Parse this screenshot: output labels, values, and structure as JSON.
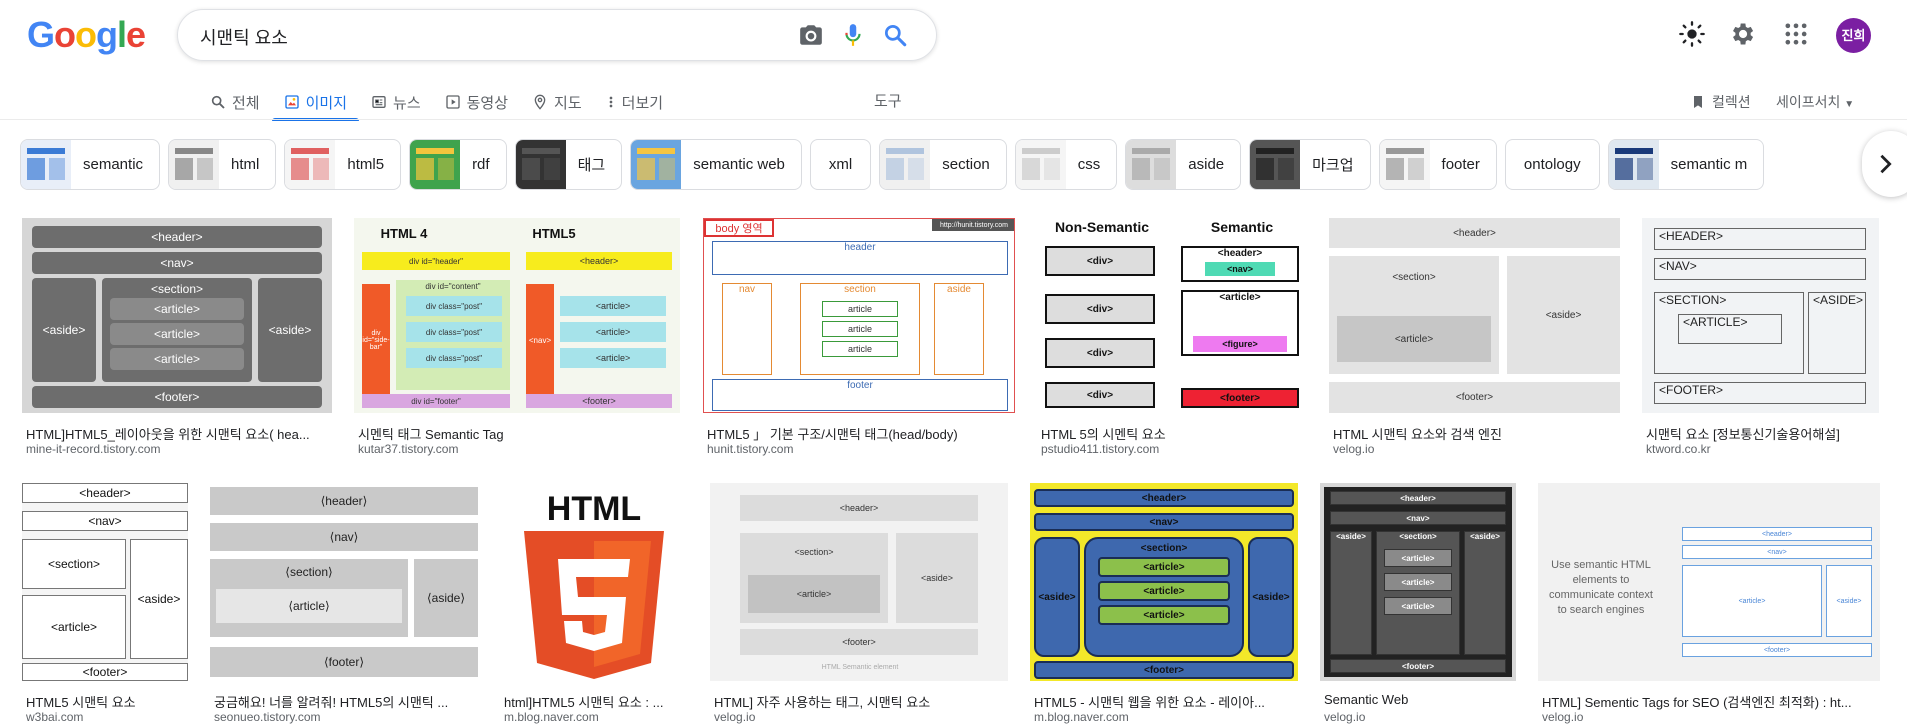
{
  "logo": "Google",
  "search": {
    "query": "시맨틱 요소"
  },
  "header": {
    "avatar_label": "진희"
  },
  "tabs": [
    {
      "label": "전체",
      "icon": "search-icon",
      "active": false
    },
    {
      "label": "이미지",
      "icon": "image-icon",
      "active": true
    },
    {
      "label": "뉴스",
      "icon": "news-icon",
      "active": false
    },
    {
      "label": "동영상",
      "icon": "video-icon",
      "active": false
    },
    {
      "label": "지도",
      "icon": "map-pin-icon",
      "active": false
    },
    {
      "label": "더보기",
      "icon": "more-vert-icon",
      "active": false
    }
  ],
  "tools_label": "도구",
  "collections_label": "컬렉션",
  "safesearch_label": "세이프서치",
  "chips": [
    {
      "label": "semantic",
      "thumb": true
    },
    {
      "label": "html",
      "thumb": true
    },
    {
      "label": "html5",
      "thumb": true
    },
    {
      "label": "rdf",
      "thumb": true
    },
    {
      "label": "태그",
      "thumb": true
    },
    {
      "label": "semantic web",
      "thumb": true
    },
    {
      "label": "xml",
      "thumb": false
    },
    {
      "label": "section",
      "thumb": true
    },
    {
      "label": "css",
      "thumb": true
    },
    {
      "label": "aside",
      "thumb": true
    },
    {
      "label": "마크업",
      "thumb": true
    },
    {
      "label": "footer",
      "thumb": true
    },
    {
      "label": "ontology",
      "thumb": false
    },
    {
      "label": "semantic m",
      "thumb": true
    }
  ],
  "results": [
    {
      "title": "HTML]HTML5_레이아웃을 위한 시맨틱 요소( hea...",
      "domain": "mine-it-record.tistory.com"
    },
    {
      "title": "시멘틱 태그 Semantic Tag",
      "domain": "kutar37.tistory.com"
    },
    {
      "title": "HTML5 」 기본 구조/시맨틱 태그(head/body)",
      "domain": "hunit.tistory.com"
    },
    {
      "title": "HTML 5의 시멘틱 요소",
      "domain": "pstudio411.tistory.com"
    },
    {
      "title": "HTML 시맨틱 요소와 검색 엔진",
      "domain": "velog.io"
    },
    {
      "title": "시맨틱 요소 [정보통신기술용어해설]",
      "domain": "ktword.co.kr"
    },
    {
      "title": "HTML5 시맨틱 요소",
      "domain": "w3bai.com"
    },
    {
      "title": "궁금해요! 너를 알려줘! HTML5의 시맨틱 ...",
      "domain": "seonueo.tistory.com"
    },
    {
      "title": "html]HTML5 시맨틱 요소 : ...",
      "domain": "m.blog.naver.com"
    },
    {
      "title": "HTML] 자주 사용하는 태그, 시맨틱 요소",
      "domain": "velog.io"
    },
    {
      "title": "HTML5 - 시맨틱 웹을 위한 요소 - 레이아...",
      "domain": "m.blog.naver.com"
    },
    {
      "title": "Semantic Web",
      "domain": "velog.io"
    },
    {
      "title": "HTML] Sementic Tags for SEO (검색엔진 최적화) : ht...",
      "domain": "velog.io"
    }
  ],
  "images": {
    "r1": {
      "header": "<header>",
      "nav": "<nav>",
      "aside": "<aside>",
      "section": "<section>",
      "article": "<article>",
      "footer": "<footer>"
    },
    "r2": {
      "left_title": "HTML 4",
      "right_title": "HTML5",
      "div_header": "div id=\"header\"",
      "div_content": "div id=\"content\"",
      "div_post": "div class=\"post\"",
      "div_footer": "div id=\"footer\"",
      "div_sidebar": "div id=\"side-bar\"",
      "header": "<header>",
      "nav": "<nav>",
      "article": "<article>",
      "footer": "<footer>"
    },
    "r3": {
      "body": "body 영역",
      "url": "http://hunit.tistory.com",
      "header": "header",
      "nav": "nav",
      "section": "section",
      "aside": "aside",
      "article": "article",
      "footer": "footer"
    },
    "r4": {
      "left": "Non-Semantic",
      "right": "Semantic",
      "div": "<div>",
      "header": "<header>",
      "nav": "<nav>",
      "article": "<article>",
      "figure": "<figure>",
      "footer": "<footer>"
    },
    "r5": {
      "header": "<header>",
      "section": "<section>",
      "article": "<article>",
      "aside": "<aside>",
      "footer": "<footer>"
    },
    "r6": {
      "header": "<HEADER>",
      "nav": "<NAV>",
      "section": "<SECTION>",
      "article": "<ARTICLE>",
      "aside": "<ASIDE>",
      "footer": "<FOOTER>"
    },
    "r7": {
      "header": "<header>",
      "nav": "<nav>",
      "section": "<section>",
      "article": "<article>",
      "aside": "<aside>",
      "footer": "<footer>"
    },
    "r8": {
      "header": "⟨header⟩",
      "nav": "⟨nav⟩",
      "section": "⟨section⟩",
      "article": "⟨article⟩",
      "aside": "⟨aside⟩",
      "footer": "⟨footer⟩"
    },
    "r9": {
      "text": "HTML",
      "digit": "5"
    },
    "r10": {
      "header": "<header>",
      "section": "<section>",
      "article": "<article>",
      "aside": "<aside>",
      "footer": "<footer>",
      "caption": "HTML Semantic element"
    },
    "r11": {
      "header": "<header>",
      "nav": "<nav>",
      "section": "<section>",
      "article": "<article>",
      "aside": "<aside>",
      "footer": "<footer>"
    },
    "r12": {
      "header": "<header>",
      "nav": "<nav>",
      "section": "<section>",
      "article": "<article>",
      "aside": "<aside>",
      "footer": "<footer>"
    },
    "r13": {
      "text": "Use semantic HTML elements to communicate context to search engines",
      "header": "<header>",
      "nav": "<nav>",
      "article": "<article>",
      "aside": "<aside>",
      "footer": "<footer>"
    }
  },
  "colors": {
    "accent": "#1a73e8",
    "avatar": "#7b1fa2"
  }
}
